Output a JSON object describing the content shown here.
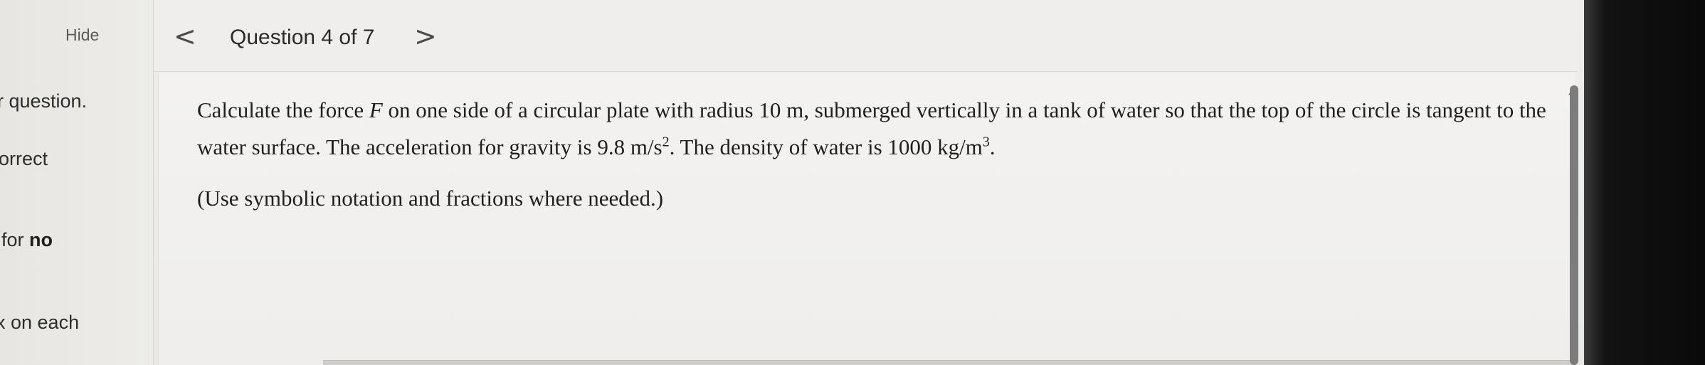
{
  "sidebar": {
    "hide_label": "Hide",
    "lines": [
      "r question.",
      "orrect",
      "for",
      "no",
      "x on each"
    ]
  },
  "nav": {
    "prev_glyph": "<",
    "title": "Question 4 of 7",
    "next_glyph": ">"
  },
  "question": {
    "part1": "Calculate the force ",
    "var_F": "F",
    "part2": " on one side of a circular plate with radius 10 m, submerged vertically in a tank of water so that the top of the circle is tangent to the water surface. The acceleration for gravity is 9.8 m/s",
    "exp1": "2",
    "part3": ". The density of water is 1000 kg/m",
    "exp2": "3",
    "part4": ".",
    "hint": "(Use symbolic notation and fractions where needed.)"
  }
}
